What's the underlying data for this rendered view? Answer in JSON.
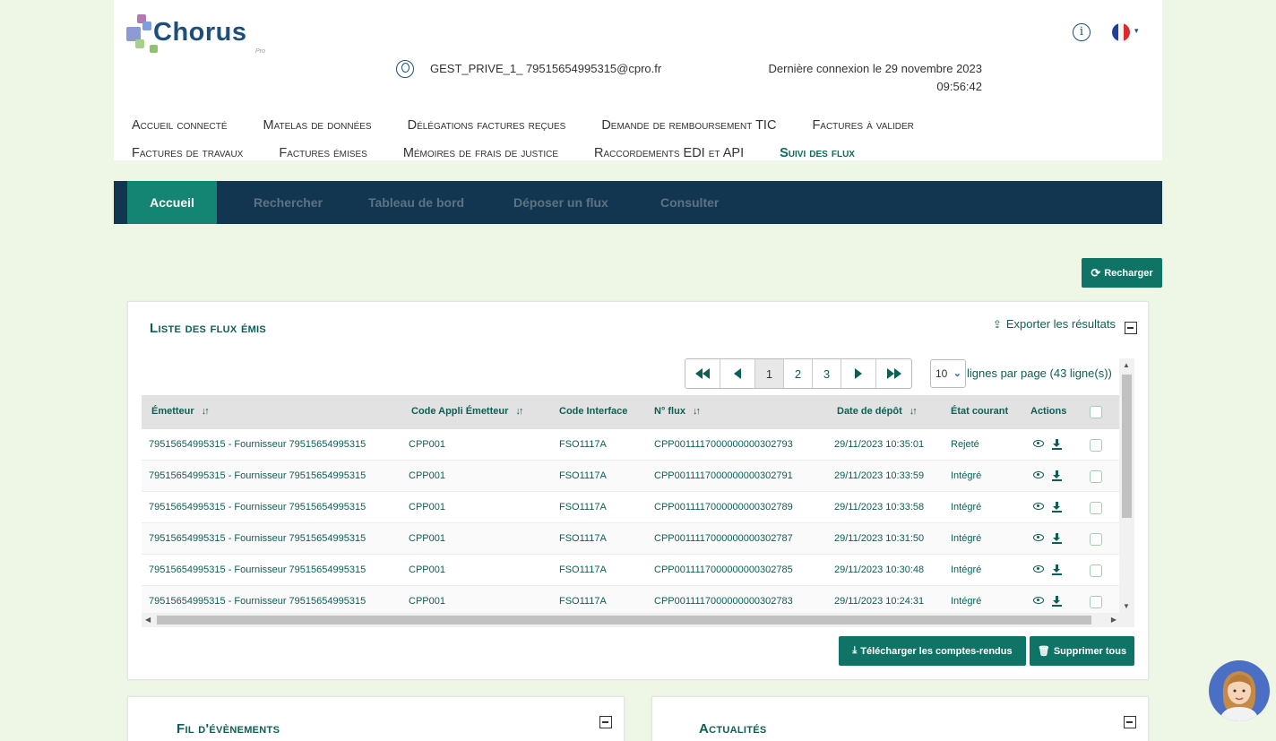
{
  "brand": {
    "name": "Chorus",
    "sub": "Pro"
  },
  "header": {
    "user": "GEST_PRIVE_1_ 79515654995315@cpro.fr",
    "last_login_line1": "Dernière connexion le 29 novembre 2023",
    "last_login_line2": "09:56:42",
    "info_symbol": "i",
    "lang_caret": "▾"
  },
  "mainnav": {
    "row1": [
      "Accueil connecté",
      "Matelas de données",
      "Délégations factures reçues",
      "Demande de remboursement TIC",
      "Factures à valider"
    ],
    "row2": [
      "Factures de travaux",
      "Factures émises",
      "Mémoires de frais de justice",
      "Raccordements EDI et API",
      "Suivi des flux"
    ]
  },
  "subnav": {
    "tabs": [
      "Accueil",
      "Rechercher",
      "Tableau de bord",
      "Déposer un flux",
      "Consulter"
    ]
  },
  "reload_label": "Recharger",
  "panel": {
    "title": "Liste des flux émis",
    "export_label": "Exporter les résultats",
    "pages": [
      "1",
      "2",
      "3"
    ],
    "per_page": "10",
    "per_page_label": "lignes par page (43 ligne(s))",
    "columns": [
      "Émetteur",
      "Code Appli Émetteur",
      "Code Interface",
      "N° flux",
      "Date de dépôt",
      "État courant",
      "Actions"
    ],
    "rows": [
      {
        "emetteur": "79515654995315 - Fournisseur 79515654995315",
        "code_appli": "CPP001",
        "code_interface": "FSO1117A",
        "flux": "CPP0011117000000000302793",
        "date": "29/11/2023 10:35:01",
        "etat": "Rejeté"
      },
      {
        "emetteur": "79515654995315 - Fournisseur 79515654995315",
        "code_appli": "CPP001",
        "code_interface": "FSO1117A",
        "flux": "CPP0011117000000000302791",
        "date": "29/11/2023 10:33:59",
        "etat": "Intégré"
      },
      {
        "emetteur": "79515654995315 - Fournisseur 79515654995315",
        "code_appli": "CPP001",
        "code_interface": "FSO1117A",
        "flux": "CPP0011117000000000302789",
        "date": "29/11/2023 10:33:58",
        "etat": "Intégré"
      },
      {
        "emetteur": "79515654995315 - Fournisseur 79515654995315",
        "code_appli": "CPP001",
        "code_interface": "FSO1117A",
        "flux": "CPP0011117000000000302787",
        "date": "29/11/2023 10:31:50",
        "etat": "Intégré"
      },
      {
        "emetteur": "79515654995315 - Fournisseur 79515654995315",
        "code_appli": "CPP001",
        "code_interface": "FSO1117A",
        "flux": "CPP0011117000000000302785",
        "date": "29/11/2023 10:30:48",
        "etat": "Intégré"
      },
      {
        "emetteur": "79515654995315 - Fournisseur 79515654995315",
        "code_appli": "CPP001",
        "code_interface": "FSO1117A",
        "flux": "CPP0011117000000000302783",
        "date": "29/11/2023 10:24:31",
        "etat": "Intégré"
      }
    ],
    "download_label": "Télécharger les comptes-rendus",
    "delete_label": "Supprimer tous"
  },
  "events_title": "Fil d'évènements",
  "news_title": "Actualités",
  "colors": {
    "primary": "#0f7466",
    "navy": "#12364f",
    "text_green": "#0e5e55",
    "bg": "#eef6e6"
  }
}
